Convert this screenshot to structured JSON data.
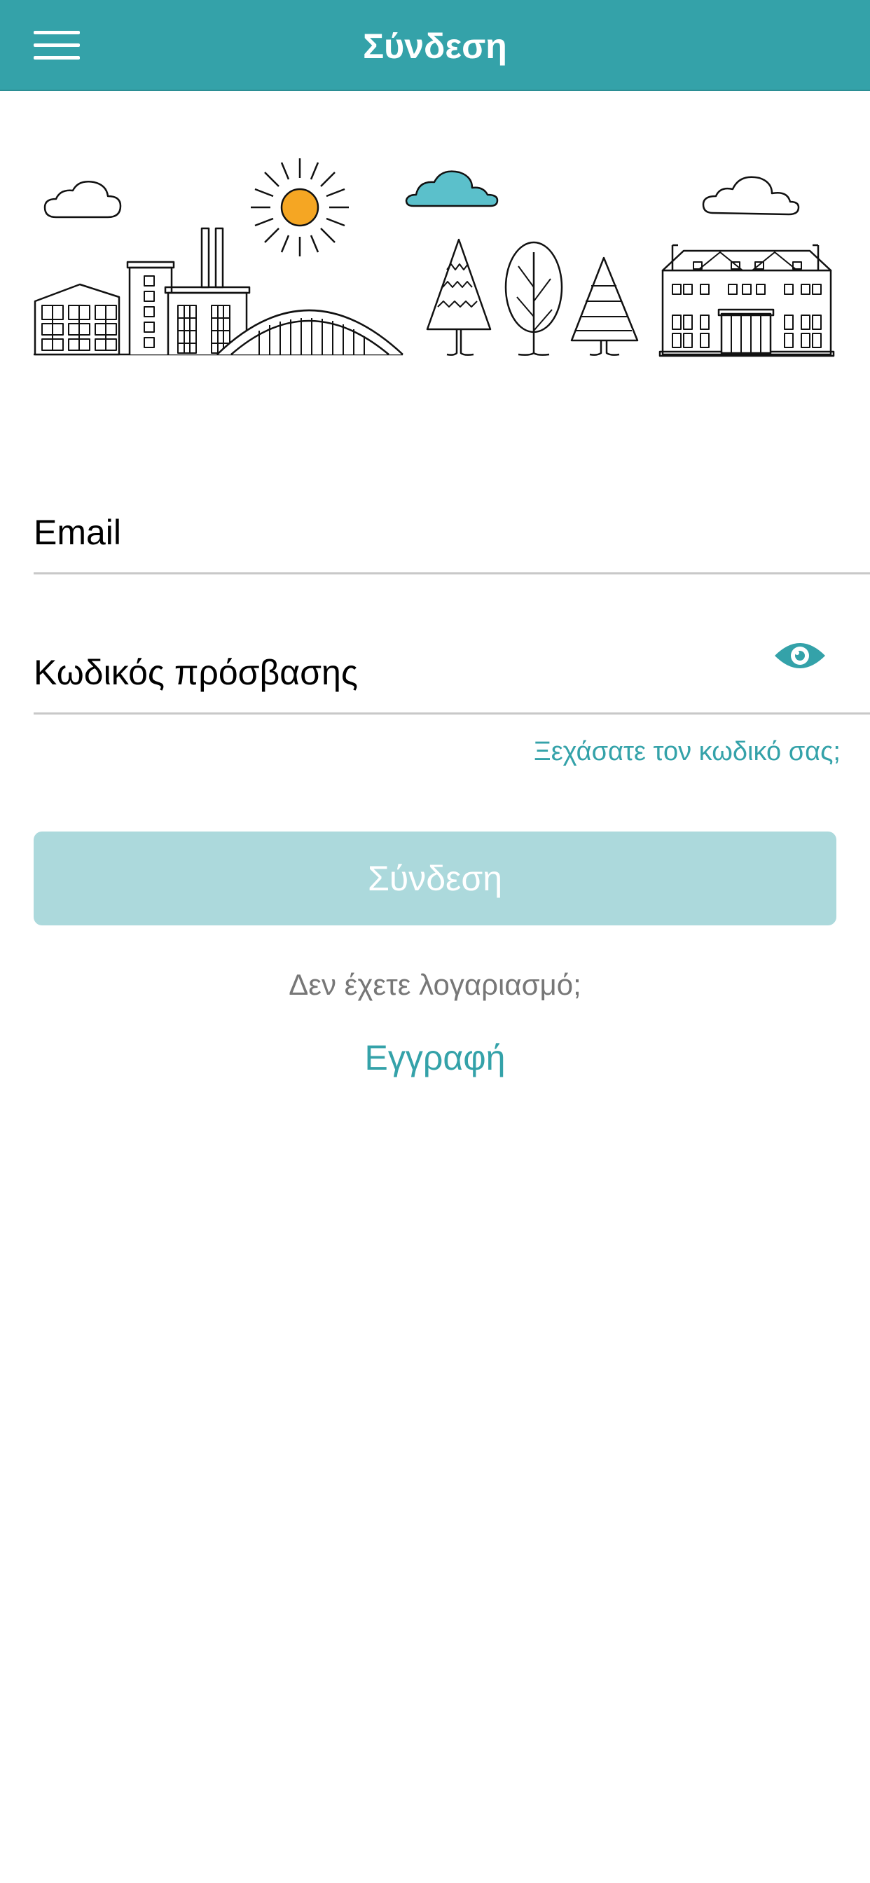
{
  "header": {
    "title": "Σύνδεση",
    "menu_icon": "hamburger-menu-icon",
    "background_color": "#34a2a9"
  },
  "hero": {
    "illustration": "cityscape-illustration",
    "sun_color": "#f5a623",
    "cloud_accent_color": "#5bc0cb"
  },
  "form": {
    "email_placeholder": "Email",
    "email_value": "",
    "password_placeholder": "Κωδικός πρόσβασης",
    "password_value": "",
    "show_password_icon": "eye-icon",
    "forgot_password": "Ξεχάσατε τον κωδικό σας;",
    "login_button": "Σύνδεση"
  },
  "footer": {
    "no_account": "Δεν έχετε λογαριασμό;",
    "register": "Εγγραφή"
  },
  "colors": {
    "accent": "#34a2a9",
    "button_disabled": "#acd9dc",
    "muted_text": "#777777"
  }
}
